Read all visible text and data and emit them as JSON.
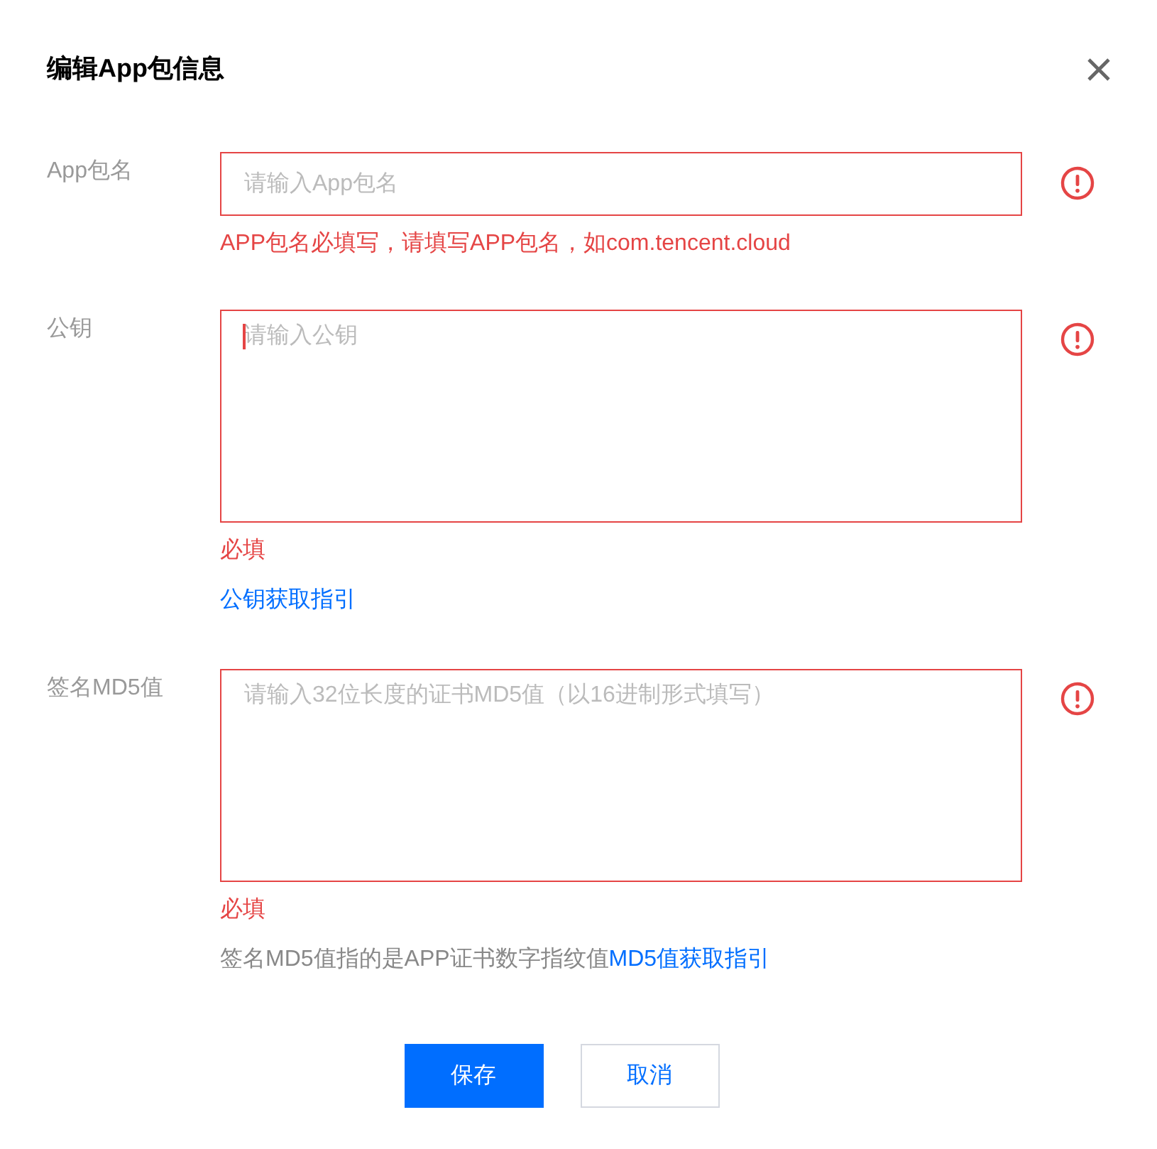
{
  "dialog": {
    "title": "编辑App包信息"
  },
  "fields": [
    {
      "label": "App包名",
      "kind": "input",
      "placeholder": "请输入App包名",
      "invalid": true,
      "focused": false,
      "messages": [
        {
          "kind": "error",
          "text": "APP包名必填写，请填写APP包名，如com.tencent.cloud"
        }
      ]
    },
    {
      "label": "公钥",
      "kind": "textarea",
      "placeholder": "请输入公钥",
      "invalid": true,
      "focused": true,
      "messages": [
        {
          "kind": "error",
          "text": "必填"
        },
        {
          "kind": "link",
          "text": "公钥获取指引"
        }
      ]
    },
    {
      "label": "签名MD5值",
      "kind": "textarea",
      "placeholder": "请输入32位长度的证书MD5值（以16进制形式填写）",
      "invalid": true,
      "focused": false,
      "messages": [
        {
          "kind": "error",
          "text": "必填"
        },
        {
          "kind": "hint",
          "text": "签名MD5值指的是APP证书数字指纹值",
          "link": "MD5值获取指引"
        }
      ]
    }
  ],
  "buttons": [
    {
      "label": "保存",
      "kind": "primary"
    },
    {
      "label": "取消",
      "kind": "secondary"
    }
  ]
}
